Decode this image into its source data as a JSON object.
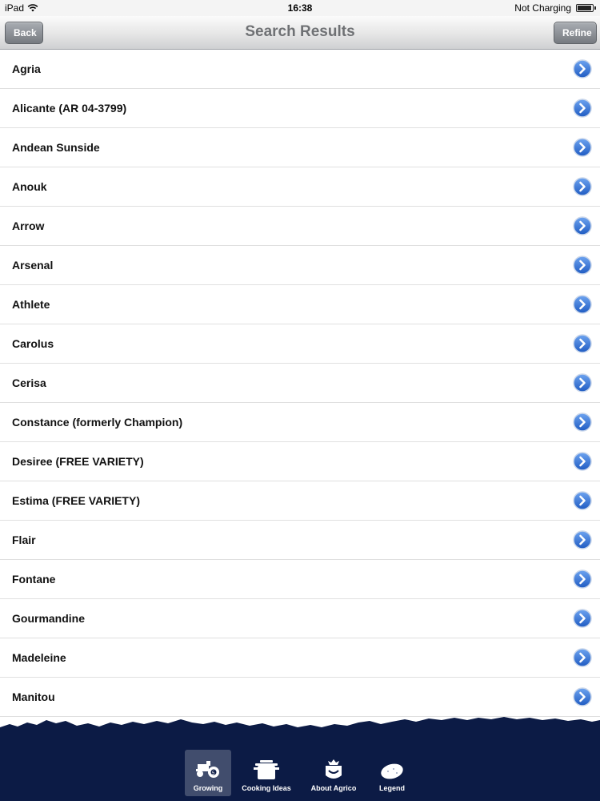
{
  "status_bar": {
    "device": "iPad",
    "time": "16:38",
    "charging": "Not Charging"
  },
  "nav": {
    "back_label": "Back",
    "title": "Search Results",
    "refine_label": "Refine"
  },
  "list": {
    "items": [
      {
        "label": "Agria"
      },
      {
        "label": "Alicante (AR 04-3799)"
      },
      {
        "label": "Andean Sunside"
      },
      {
        "label": "Anouk"
      },
      {
        "label": "Arrow"
      },
      {
        "label": "Arsenal"
      },
      {
        "label": "Athlete"
      },
      {
        "label": "Carolus"
      },
      {
        "label": "Cerisa"
      },
      {
        "label": "Constance (formerly Champion)"
      },
      {
        "label": "Desiree (FREE VARIETY)"
      },
      {
        "label": "Estima (FREE VARIETY)"
      },
      {
        "label": "Flair"
      },
      {
        "label": "Fontane"
      },
      {
        "label": "Gourmandine"
      },
      {
        "label": "Madeleine"
      },
      {
        "label": "Manitou"
      }
    ]
  },
  "tabbar": {
    "tabs": [
      {
        "label": "Growing",
        "icon": "tractor-icon",
        "selected": true
      },
      {
        "label": "Cooking Ideas",
        "icon": "pot-icon",
        "selected": false
      },
      {
        "label": "About Agrico",
        "icon": "agrico-logo-icon",
        "selected": false
      },
      {
        "label": "Legend",
        "icon": "potato-icon",
        "selected": false
      }
    ]
  },
  "colors": {
    "tabbar_bg": "#0c1b45",
    "disclosure_blue": "#2f6fd1",
    "nav_title": "#6f7174"
  }
}
